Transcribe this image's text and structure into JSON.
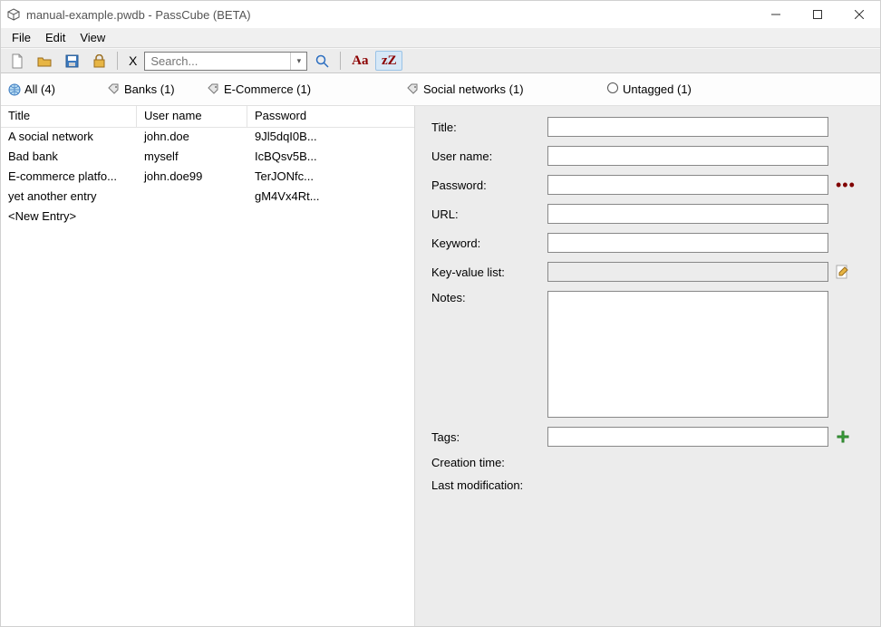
{
  "window": {
    "title": "manual-example.pwdb - PassCube (BETA)"
  },
  "menu": {
    "file": "File",
    "edit": "Edit",
    "view": "View"
  },
  "toolbar": {
    "clear_x": "X",
    "search_placeholder": "Search...",
    "aa": "Aa",
    "zz": "zZ"
  },
  "filters": {
    "all": "All (4)",
    "banks": "Banks (1)",
    "ecom": "E-Commerce (1)",
    "social": "Social networks (1)",
    "untag": "Untagged (1)"
  },
  "columns": {
    "title": "Title",
    "user": "User name",
    "pass": "Password"
  },
  "rows": [
    {
      "title": "A social network",
      "user": "john.doe",
      "pass": "9Jl5dqI0B..."
    },
    {
      "title": "Bad bank",
      "user": "myself",
      "pass": "IcBQsv5B..."
    },
    {
      "title": "E-commerce platfo...",
      "user": "john.doe99",
      "pass": "TerJONfc..."
    },
    {
      "title": "yet another entry",
      "user": "",
      "pass": "gM4Vx4Rt..."
    },
    {
      "title": "<New Entry>",
      "user": "",
      "pass": ""
    }
  ],
  "form": {
    "title_lbl": "Title:",
    "user_lbl": "User name:",
    "pass_lbl": "Password:",
    "url_lbl": "URL:",
    "keyword_lbl": "Keyword:",
    "kv_lbl": "Key-value list:",
    "notes_lbl": "Notes:",
    "tags_lbl": "Tags:",
    "ctime_lbl": "Creation time:",
    "mtime_lbl": "Last modification:",
    "title": "",
    "user": "",
    "pass": "",
    "url": "",
    "keyword": "",
    "kv": "",
    "notes": "",
    "tags": "",
    "ctime": "",
    "mtime": ""
  }
}
